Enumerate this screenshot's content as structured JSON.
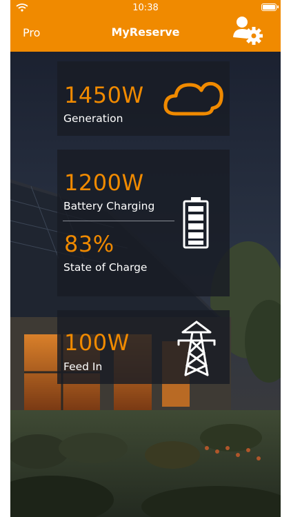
{
  "status_bar": {
    "time": "10:38"
  },
  "nav": {
    "left_label": "Pro",
    "title": "MyReserve"
  },
  "generation": {
    "value": "1450W",
    "label": "Generation"
  },
  "battery": {
    "charging_value": "1200W",
    "charging_label": "Battery Charging",
    "soc_value": "83%",
    "soc_label": "State of Charge"
  },
  "feed_in": {
    "value": "100W",
    "label": "Feed In"
  },
  "icons": {
    "status": [
      "wifi-icon",
      "battery-icon"
    ],
    "header": [
      "user-settings-icon"
    ],
    "cards": [
      "cloud-icon",
      "battery-level-icon",
      "power-pylon-icon"
    ]
  },
  "colors": {
    "accent": "#f08a00",
    "card": "#191c24",
    "text": "#ffffff"
  }
}
